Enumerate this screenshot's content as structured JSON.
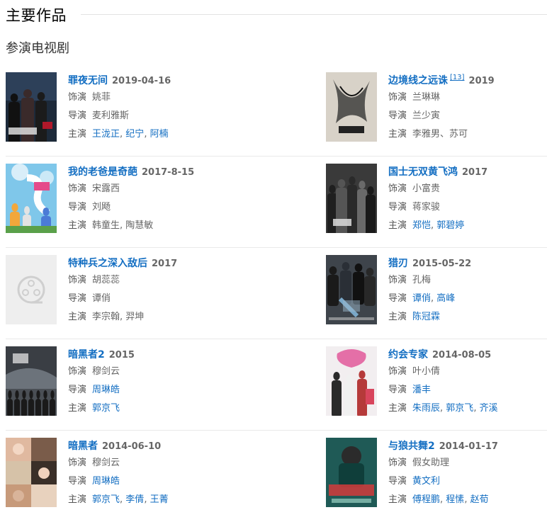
{
  "section": {
    "title": "主要作品"
  },
  "subsection": {
    "title": "参演电视剧"
  },
  "labels": {
    "role": "饰演",
    "director": "导演",
    "cast": "主演"
  },
  "rows": [
    {
      "left": {
        "title": "罪夜无间",
        "sup": "",
        "year": "2019-04-16",
        "role": "姚菲",
        "director": [
          {
            "name": "麦利雅斯",
            "link": false
          }
        ],
        "cast": [
          {
            "name": "王泷正",
            "link": true
          },
          {
            "name": "纪宁",
            "link": true
          },
          {
            "name": "阿楠",
            "link": true
          }
        ],
        "cast_sep": ", ",
        "poster": {
          "theme": "dark-crowd",
          "bg": "#1d2a3a"
        }
      },
      "right": {
        "title": "边境线之远诛",
        "sup": "[13]",
        "year": "2019",
        "role": "兰琳琳",
        "director": [
          {
            "name": "兰少寅",
            "link": false
          }
        ],
        "cast": [
          {
            "name": "李雅男、苏可",
            "link": false
          }
        ],
        "cast_sep": "",
        "poster": {
          "theme": "ink",
          "bg": "#d8d2c8"
        }
      }
    },
    {
      "left": {
        "title": "我的老爸是奇葩",
        "sup": "",
        "year": "2017-8-15",
        "role": "宋露西",
        "director": [
          {
            "name": "刘飏",
            "link": false
          }
        ],
        "cast": [
          {
            "name": "韩童生",
            "link": false
          },
          {
            "name": "陶慧敏",
            "link": false
          }
        ],
        "cast_sep": ", ",
        "poster": {
          "theme": "sky",
          "bg": "#7fc7ea"
        }
      },
      "right": {
        "title": "国士无双黄飞鸿",
        "sup": "",
        "year": "2017",
        "role": "小富贵",
        "director": [
          {
            "name": "蒋家骏",
            "link": false
          }
        ],
        "cast": [
          {
            "name": "郑恺",
            "link": true
          },
          {
            "name": "郭碧婷",
            "link": true
          }
        ],
        "cast_sep": ", ",
        "poster": {
          "theme": "group-dark",
          "bg": "#3a3a3a"
        }
      }
    },
    {
      "left": {
        "title": "特种兵之深入敌后",
        "sup": "",
        "year": "2017",
        "role": "胡蕊蕊",
        "director": [
          {
            "name": "谭俏",
            "link": false
          }
        ],
        "cast": [
          {
            "name": "李宗翰",
            "link": false
          },
          {
            "name": "羿坤",
            "link": false
          }
        ],
        "cast_sep": ", ",
        "poster": {
          "theme": "placeholder",
          "bg": "#eeeeee"
        }
      },
      "right": {
        "title": "猎刃",
        "sup": "",
        "year": "2015-05-22",
        "role": "孔梅",
        "director": [
          {
            "name": "谭俏",
            "link": true
          },
          {
            "name": "高峰",
            "link": true
          }
        ],
        "cast": [
          {
            "name": "陈冠霖",
            "link": true
          }
        ],
        "cast_sep": ", ",
        "poster": {
          "theme": "action",
          "bg": "#2c2f34"
        }
      }
    },
    {
      "left": {
        "title": "暗黑者2",
        "sup": "",
        "year": "2015",
        "role": "穆剑云",
        "director": [
          {
            "name": "周琳皓",
            "link": true
          }
        ],
        "cast": [
          {
            "name": "郭京飞",
            "link": true
          }
        ],
        "cast_sep": ", ",
        "poster": {
          "theme": "stormy",
          "bg": "#4a4f55"
        }
      },
      "right": {
        "title": "约会专家",
        "sup": "",
        "year": "2014-08-05",
        "role": "叶小倩",
        "director": [
          {
            "name": "潘丰",
            "link": true
          }
        ],
        "cast": [
          {
            "name": "朱雨辰",
            "link": true
          },
          {
            "name": "郭京飞",
            "link": true
          },
          {
            "name": "齐溪",
            "link": true
          }
        ],
        "cast_sep": ", ",
        "poster": {
          "theme": "pink",
          "bg": "#f2eef0"
        }
      }
    },
    {
      "left": {
        "title": "暗黑者",
        "sup": "",
        "year": "2014-06-10",
        "role": "穆剑云",
        "director": [
          {
            "name": "周琳皓",
            "link": true
          }
        ],
        "cast": [
          {
            "name": "郭京飞",
            "link": true
          },
          {
            "name": "李倩",
            "link": true
          },
          {
            "name": "王菁",
            "link": true
          }
        ],
        "cast_sep": ", ",
        "poster": {
          "theme": "faces",
          "bg": "#5a4a3e"
        }
      },
      "right": {
        "title": "与狼共舞2",
        "sup": "",
        "year": "2014-01-17",
        "role": "假女助理",
        "director": [
          {
            "name": "黄文利",
            "link": true
          }
        ],
        "cast": [
          {
            "name": "傅程鹏",
            "link": true
          },
          {
            "name": "程愫",
            "link": true
          },
          {
            "name": "赵荀",
            "link": true
          }
        ],
        "cast_sep": ", ",
        "poster": {
          "theme": "teal",
          "bg": "#1f5a56"
        }
      }
    }
  ]
}
